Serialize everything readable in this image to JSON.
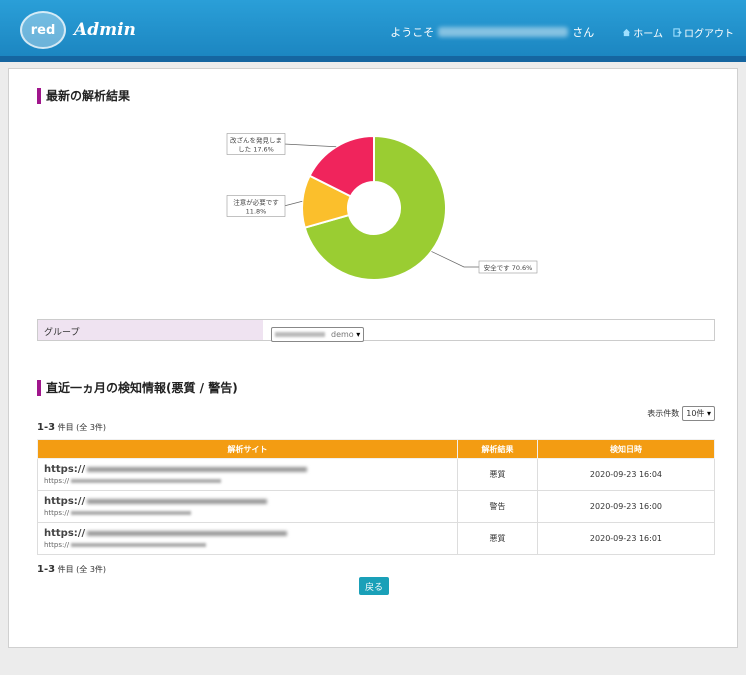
{
  "header": {
    "logo_badge": "red",
    "logo_text": "Admin",
    "welcome": "ようこそ",
    "san": "さん",
    "home_link": "ホーム",
    "logout_link": "ログアウト",
    "accent": "#1c86c1"
  },
  "analysis": {
    "title": "最新の解析結果"
  },
  "chart_data": {
    "type": "pie",
    "donut": true,
    "slices": [
      {
        "label": "安全です 70.6%",
        "value": 70.6,
        "color": "#9acd32"
      },
      {
        "label": "注意が必要です 11.8%",
        "value": 11.8,
        "color": "#fbbf2c"
      },
      {
        "label": "改ざんを発見しました 17.6%",
        "value": 17.6,
        "color": "#f0245c"
      }
    ],
    "label_lines": {
      "safe": [
        "安全です 70.6%"
      ],
      "caution": [
        "注意が必要です",
        "11.8%"
      ],
      "tampered": [
        "改ざんを発見しま",
        "した 17.6%"
      ]
    }
  },
  "group": {
    "label": "グループ",
    "selected_suffix": "demo"
  },
  "detections": {
    "title": "直近一ヵ月の検知情報(悪質 / 警告)",
    "per_page_label": "表示件数",
    "per_page_value": "10件",
    "count_num": "1-3",
    "count_text": "件目 (全 3件)",
    "columns": [
      "解析サイト",
      "解析結果",
      "検知日時"
    ],
    "rows": [
      {
        "url_prefix": "https://",
        "url2_prefix": "https://",
        "result": "悪質",
        "date": "2020-09-23 16:04"
      },
      {
        "url_prefix": "https://",
        "url2_prefix": "https://",
        "result": "警告",
        "date": "2020-09-23 16:00"
      },
      {
        "url_prefix": "https://",
        "url2_prefix": "https://",
        "result": "悪質",
        "date": "2020-09-23 16:01"
      }
    ],
    "back_button": "戻る"
  }
}
